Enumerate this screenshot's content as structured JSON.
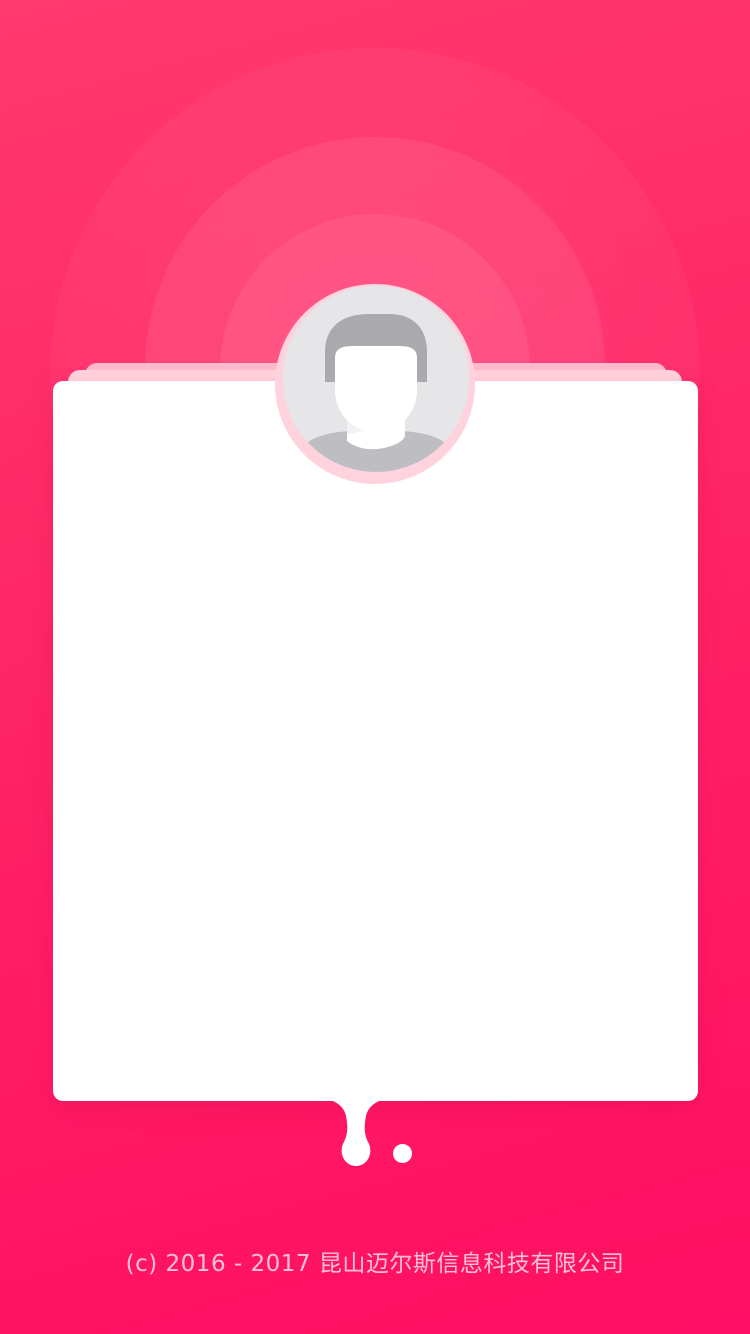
{
  "avatar": {
    "icon": "user-placeholder-icon",
    "colors": {
      "background": "#e6e6e8",
      "hair": "#a9a9ae",
      "face": "#ffffff",
      "shoulders": "#bdbdc2"
    }
  },
  "card": {
    "background_color": "#ffffff"
  },
  "pager": {
    "page_count": 2,
    "active_index": 0
  },
  "footer": {
    "copyright": "(c) 2016 - 2017 昆山迈尔斯信息科技有限公司"
  },
  "theme": {
    "background_top": "#ff3a6d",
    "background_bottom": "#ff0e62",
    "card_edge_light": "#ffd3de",
    "card_edge_dark": "#ffb9cc"
  }
}
